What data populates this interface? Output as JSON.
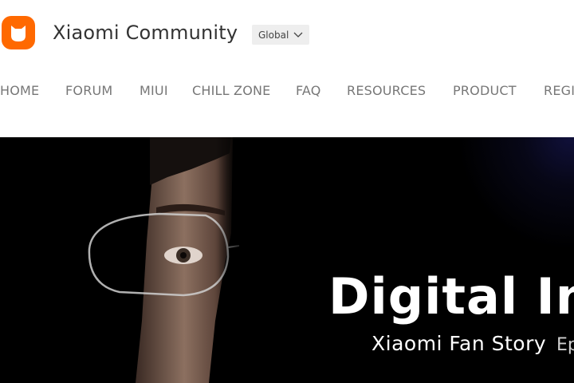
{
  "header": {
    "logo_icon": "mi-bunny-logo-icon",
    "site_title": "Xiaomi Community",
    "region_selector": {
      "label": "Global",
      "icon": "chevron-down-icon"
    }
  },
  "nav": {
    "items": [
      {
        "label": "HOME"
      },
      {
        "label": "FORUM"
      },
      {
        "label": "MIUI"
      },
      {
        "label": "CHILL ZONE"
      },
      {
        "label": "FAQ"
      },
      {
        "label": "RESOURCES"
      },
      {
        "label": "PRODUCT"
      },
      {
        "label": "REGI"
      }
    ]
  },
  "banner": {
    "title": "Digital Ink",
    "subtitle": "Xiaomi Fan Story",
    "subtitle_suffix": "Ep"
  },
  "colors": {
    "brand_orange": "#ff6900",
    "nav_text": "#777777",
    "title_text": "#333333",
    "banner_bg": "#000000"
  }
}
